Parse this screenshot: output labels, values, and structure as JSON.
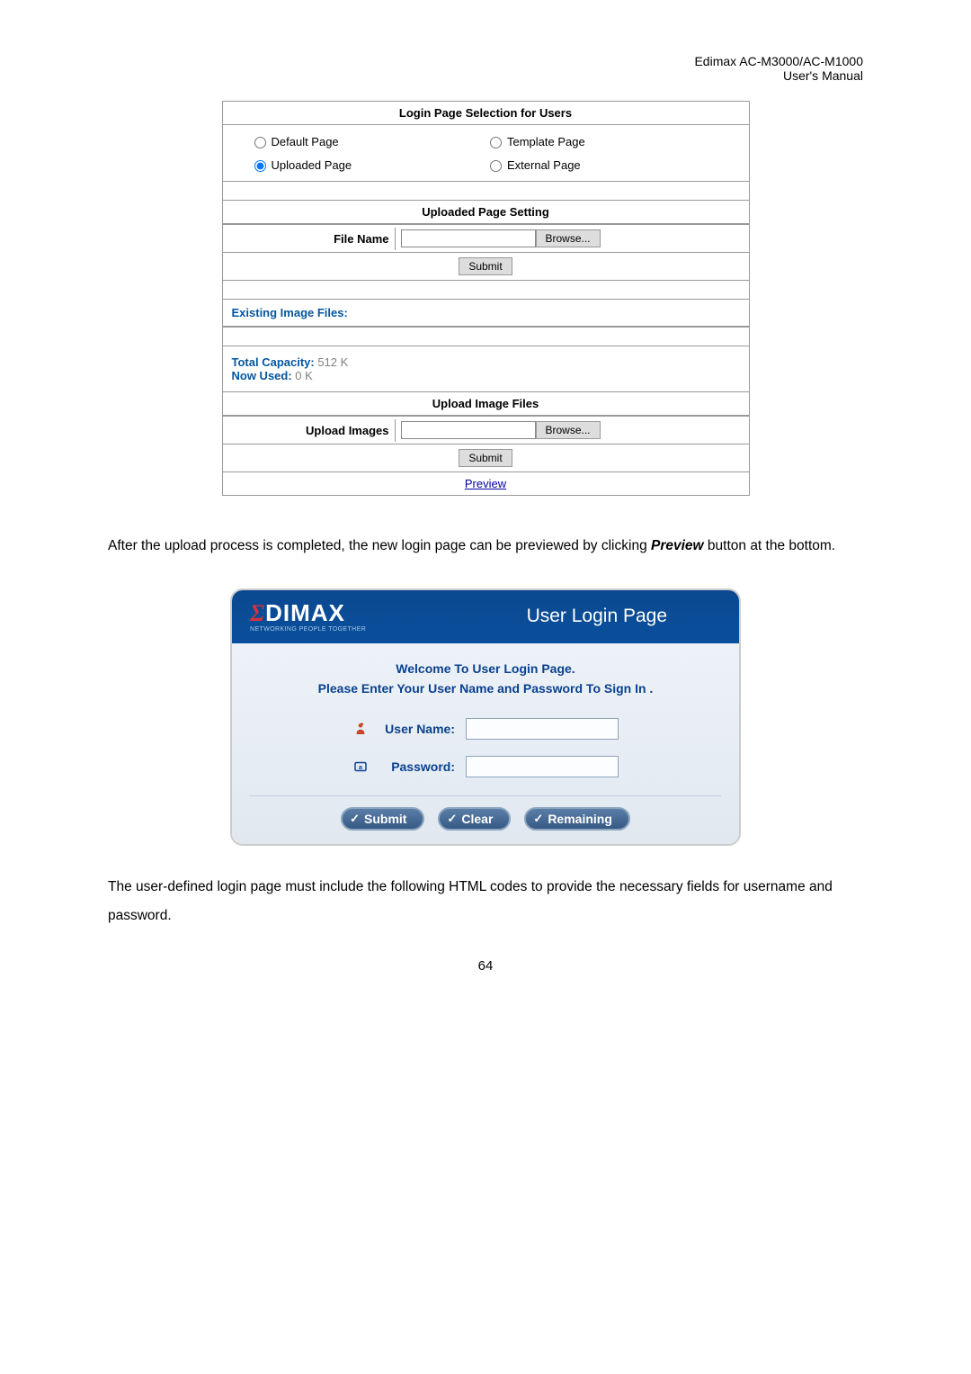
{
  "header": {
    "product": "Edimax  AC-M3000/AC-M1000",
    "doc": "User's  Manual"
  },
  "config": {
    "selectionTitle": "Login Page Selection for Users",
    "radios": {
      "default": "Default Page",
      "template": "Template Page",
      "uploaded": "Uploaded Page",
      "external": "External Page"
    },
    "uploadedSettingTitle": "Uploaded Page Setting",
    "fileNameLabel": "File Name",
    "browse": "Browse...",
    "submit": "Submit",
    "existingTitle": "Existing Image Files:",
    "totalCapacityLabel": "Total Capacity:",
    "totalCapacityValue": " 512 K",
    "nowUsedLabel": "Now Used:",
    "nowUsedValue": " 0 K",
    "uploadImageTitle": "Upload Image Files",
    "uploadImagesLabel": "Upload Images",
    "preview": "Preview"
  },
  "text1a": "After the upload process is completed, the new login page can be previewed by clicking ",
  "text1b": "Preview",
  "text1c": " button at the bottom.",
  "loginPreview": {
    "logoRed": "Σ",
    "logoRest": "DIMAX",
    "tagline": "NETWORKING PEOPLE TOGETHER",
    "title": "User Login Page",
    "welcome": "Welcome To User Login Page.",
    "instruct": "Please Enter Your User Name and Password To Sign In .",
    "usernameLabel": "User Name:",
    "passwordLabel": "Password:",
    "submitBtn": "Submit",
    "clearBtn": "Clear",
    "remainingBtn": "Remaining"
  },
  "text2": "The user-defined login page must include the following HTML codes to provide the necessary fields for username and password.",
  "pageNumber": "64"
}
